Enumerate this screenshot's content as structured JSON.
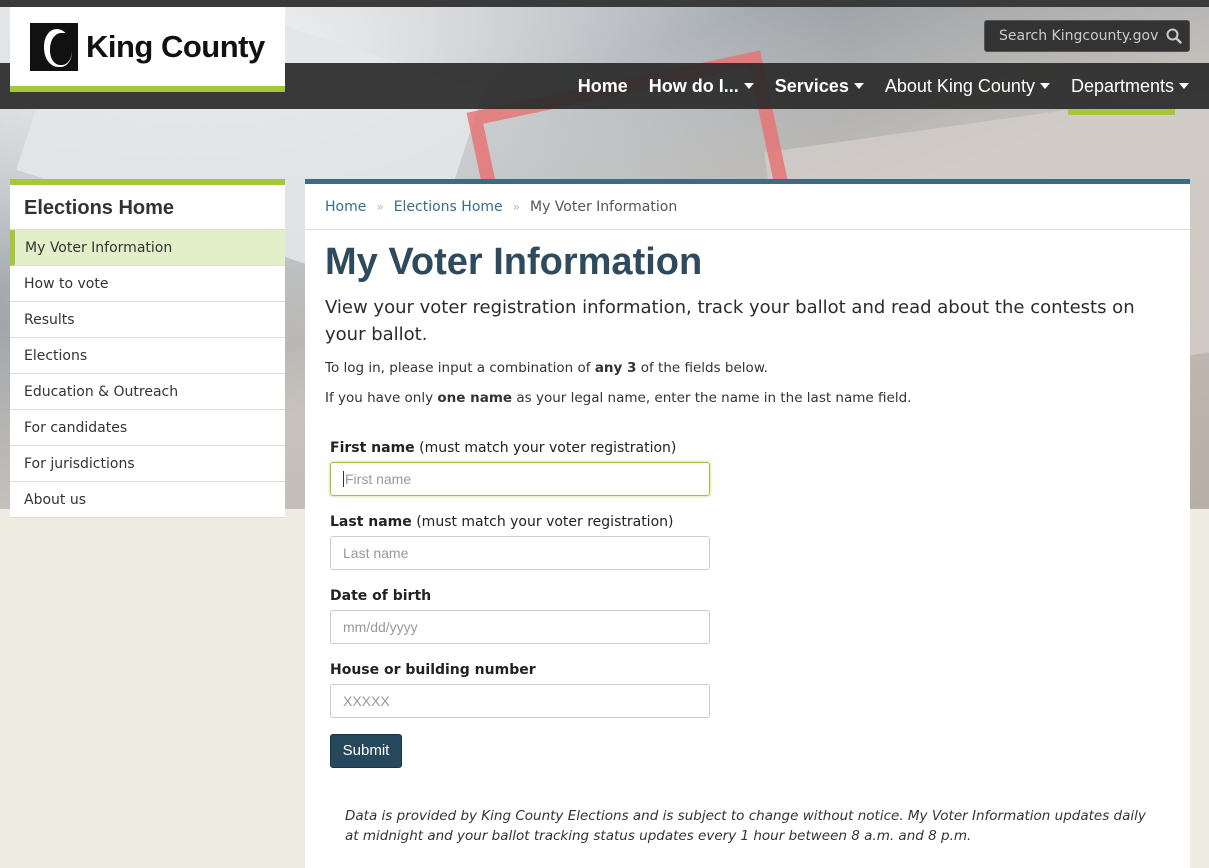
{
  "header": {
    "logo_text": "King County",
    "search_placeholder": "Search Kingcounty.gov",
    "nav": [
      {
        "label": "Home"
      },
      {
        "label": "How do I..."
      },
      {
        "label": "Services"
      },
      {
        "label": "About King County"
      },
      {
        "label": "Departments"
      }
    ]
  },
  "sidebar": {
    "title": "Elections Home",
    "items": [
      {
        "label": "My Voter Information"
      },
      {
        "label": "How to vote"
      },
      {
        "label": "Results"
      },
      {
        "label": "Elections"
      },
      {
        "label": "Education & Outreach"
      },
      {
        "label": "For candidates"
      },
      {
        "label": "For jurisdictions"
      },
      {
        "label": "About us"
      }
    ]
  },
  "breadcrumb": {
    "items": [
      "Home",
      "Elections Home"
    ],
    "current": "My Voter Information"
  },
  "main": {
    "title": "My Voter Information",
    "lead": "View your voter registration information, track your ballot and read about the contests on your ballot.",
    "para1_pre": "To log in, please input a combination of ",
    "para1_bold": "any 3",
    "para1_post": " of the fields below.",
    "para2_pre": "If you have only ",
    "para2_bold": "one name",
    "para2_post": " as your legal name, enter the name in the last name field."
  },
  "form": {
    "first_name": {
      "label": "First name",
      "note": " (must match your voter registration)",
      "placeholder": "First name"
    },
    "last_name": {
      "label": "Last name",
      "note": " (must match your voter registration)",
      "placeholder": "Last name"
    },
    "dob": {
      "label": "Date of birth",
      "placeholder": "mm/dd/yyyy"
    },
    "house": {
      "label": "House or building number",
      "placeholder": "XXXXX"
    },
    "submit_label": "Submit"
  },
  "footnote": "Data is provided by King County Elections and is subject to change without notice. My Voter Information updates daily at midnight and your ballot tracking status updates every 1 hour between 8 a.m. and 8 p.m.",
  "colors": {
    "accent_green": "#a5c83a",
    "nav_dark": "#2a2a2a",
    "title_blue": "#2e4a5c",
    "submit_blue": "#26485c"
  }
}
